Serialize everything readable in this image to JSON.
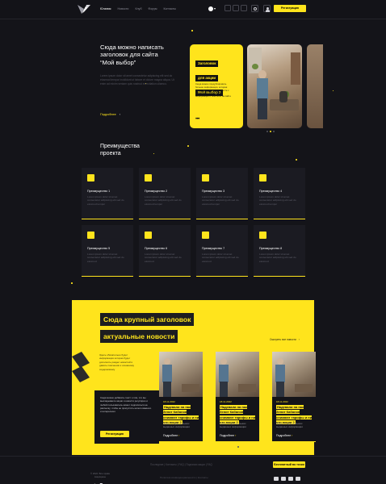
{
  "header": {
    "nav": [
      "Юлания",
      "Новости",
      "Клуб",
      "Форум",
      "Контакты"
    ],
    "lang": "▾",
    "register": "Регистрация"
  },
  "hero": {
    "title_l1": "Сюда можно написать",
    "title_l2": "заголовок для сайта",
    "title_l3": "“Мой выбор”",
    "body": "Lorem ipsum dolor sit amet consectetur adipiscing elit sed do eiusmod tempor incididunt ut labore et dolore magna aliqua. Ut enim ad minim veniam quis nostrud exercitation ullamco.",
    "more": "Подробнее",
    "promo_l1": "Заголовок",
    "promo_l2": "для акции",
    "promo_l3": "Мой выбор 2",
    "promo_desc": "Сюда можно продублировать больше информации, которая может быть интересна вместе с акцией или любой другой информации о чем-либо на сайте"
  },
  "features": {
    "title_l1": "Преимущества",
    "title_l2": "проекта",
    "items": [
      {
        "title": "Преимущество 1",
        "desc": "Lorem ipsum dolor sit amet consectetur adipiscing elit sed do eiusmod tempor"
      },
      {
        "title": "Преимущество 2",
        "desc": "Lorem ipsum dolor sit amet consectetur adipiscing elit sed do eiusmod tempor"
      },
      {
        "title": "Преимущество 3",
        "desc": "Lorem ipsum dolor sit amet consectetur adipiscing elit sed do eiusmod tempor"
      },
      {
        "title": "Преимущество 4",
        "desc": "Lorem ipsum dolor sit amet consectetur adipiscing elit sed do eiusmod tempor"
      },
      {
        "title": "Преимущество 5",
        "desc": "Lorem ipsum dolor sit amet consectetur adipiscing elit sed do eiusmod"
      },
      {
        "title": "Преимущество 6",
        "desc": "Lorem ipsum dolor sit amet consectetur adipiscing elit sed do eiusmod"
      },
      {
        "title": "Преимущество 7",
        "desc": "Lorem ipsum dolor sit amet consectetur adipiscing elit sed do eiusmod"
      },
      {
        "title": "Преимущество 8",
        "desc": "Lorem ipsum dolor sit amet consectetur adipiscing elit sed do eiusmod"
      }
    ]
  },
  "news": {
    "head_l1": "Сюда крупный заголовок",
    "head_l2": "актуальные новости",
    "all_link": "Смотреть все новости",
    "side_text": "Здесь обязательно будет информация которая будет дополнять раздел новостей и давать пояснения к основному содержимому",
    "side_text2": "Сюда можно добавить текст о том, что вы выкладываете акции и новости регулярно и любой пользователь может подписаться на рассылку, чтобы не пропустить ничего важного и интересного",
    "register": "Регистрация",
    "cards": [
      {
        "date": "18.11.2022",
        "title": "Надевали на пак Зенит Кабанов снимают тарифы и ни что акции 2",
        "desc": "Какая то одна больших выданных информации"
      },
      {
        "date": "18.11.2022",
        "title": "Надевали на пак Зенит Кабанов снимают тарифы и ни что акции 2",
        "desc": "Какая то одна больших выданных информации"
      },
      {
        "date": "18.11.2022",
        "title": "Надевали на пак Зенит Кабанов снимают тарифы и ни что акции 2",
        "desc": "Какая то одна больших выданных информации"
      }
    ],
    "more": "Подробнее"
  },
  "footer": {
    "copy_l1": "© 2022. Все права",
    "copy_l2": "защищены",
    "links": "Последние | Контакты | FAQ | Подписки акции | FAQ",
    "policy": "Политика конфиденциальности | Контакты",
    "cta": "Бесплатный во точки"
  },
  "colors": {
    "accent": "#ffe41c",
    "bg": "#141419"
  }
}
